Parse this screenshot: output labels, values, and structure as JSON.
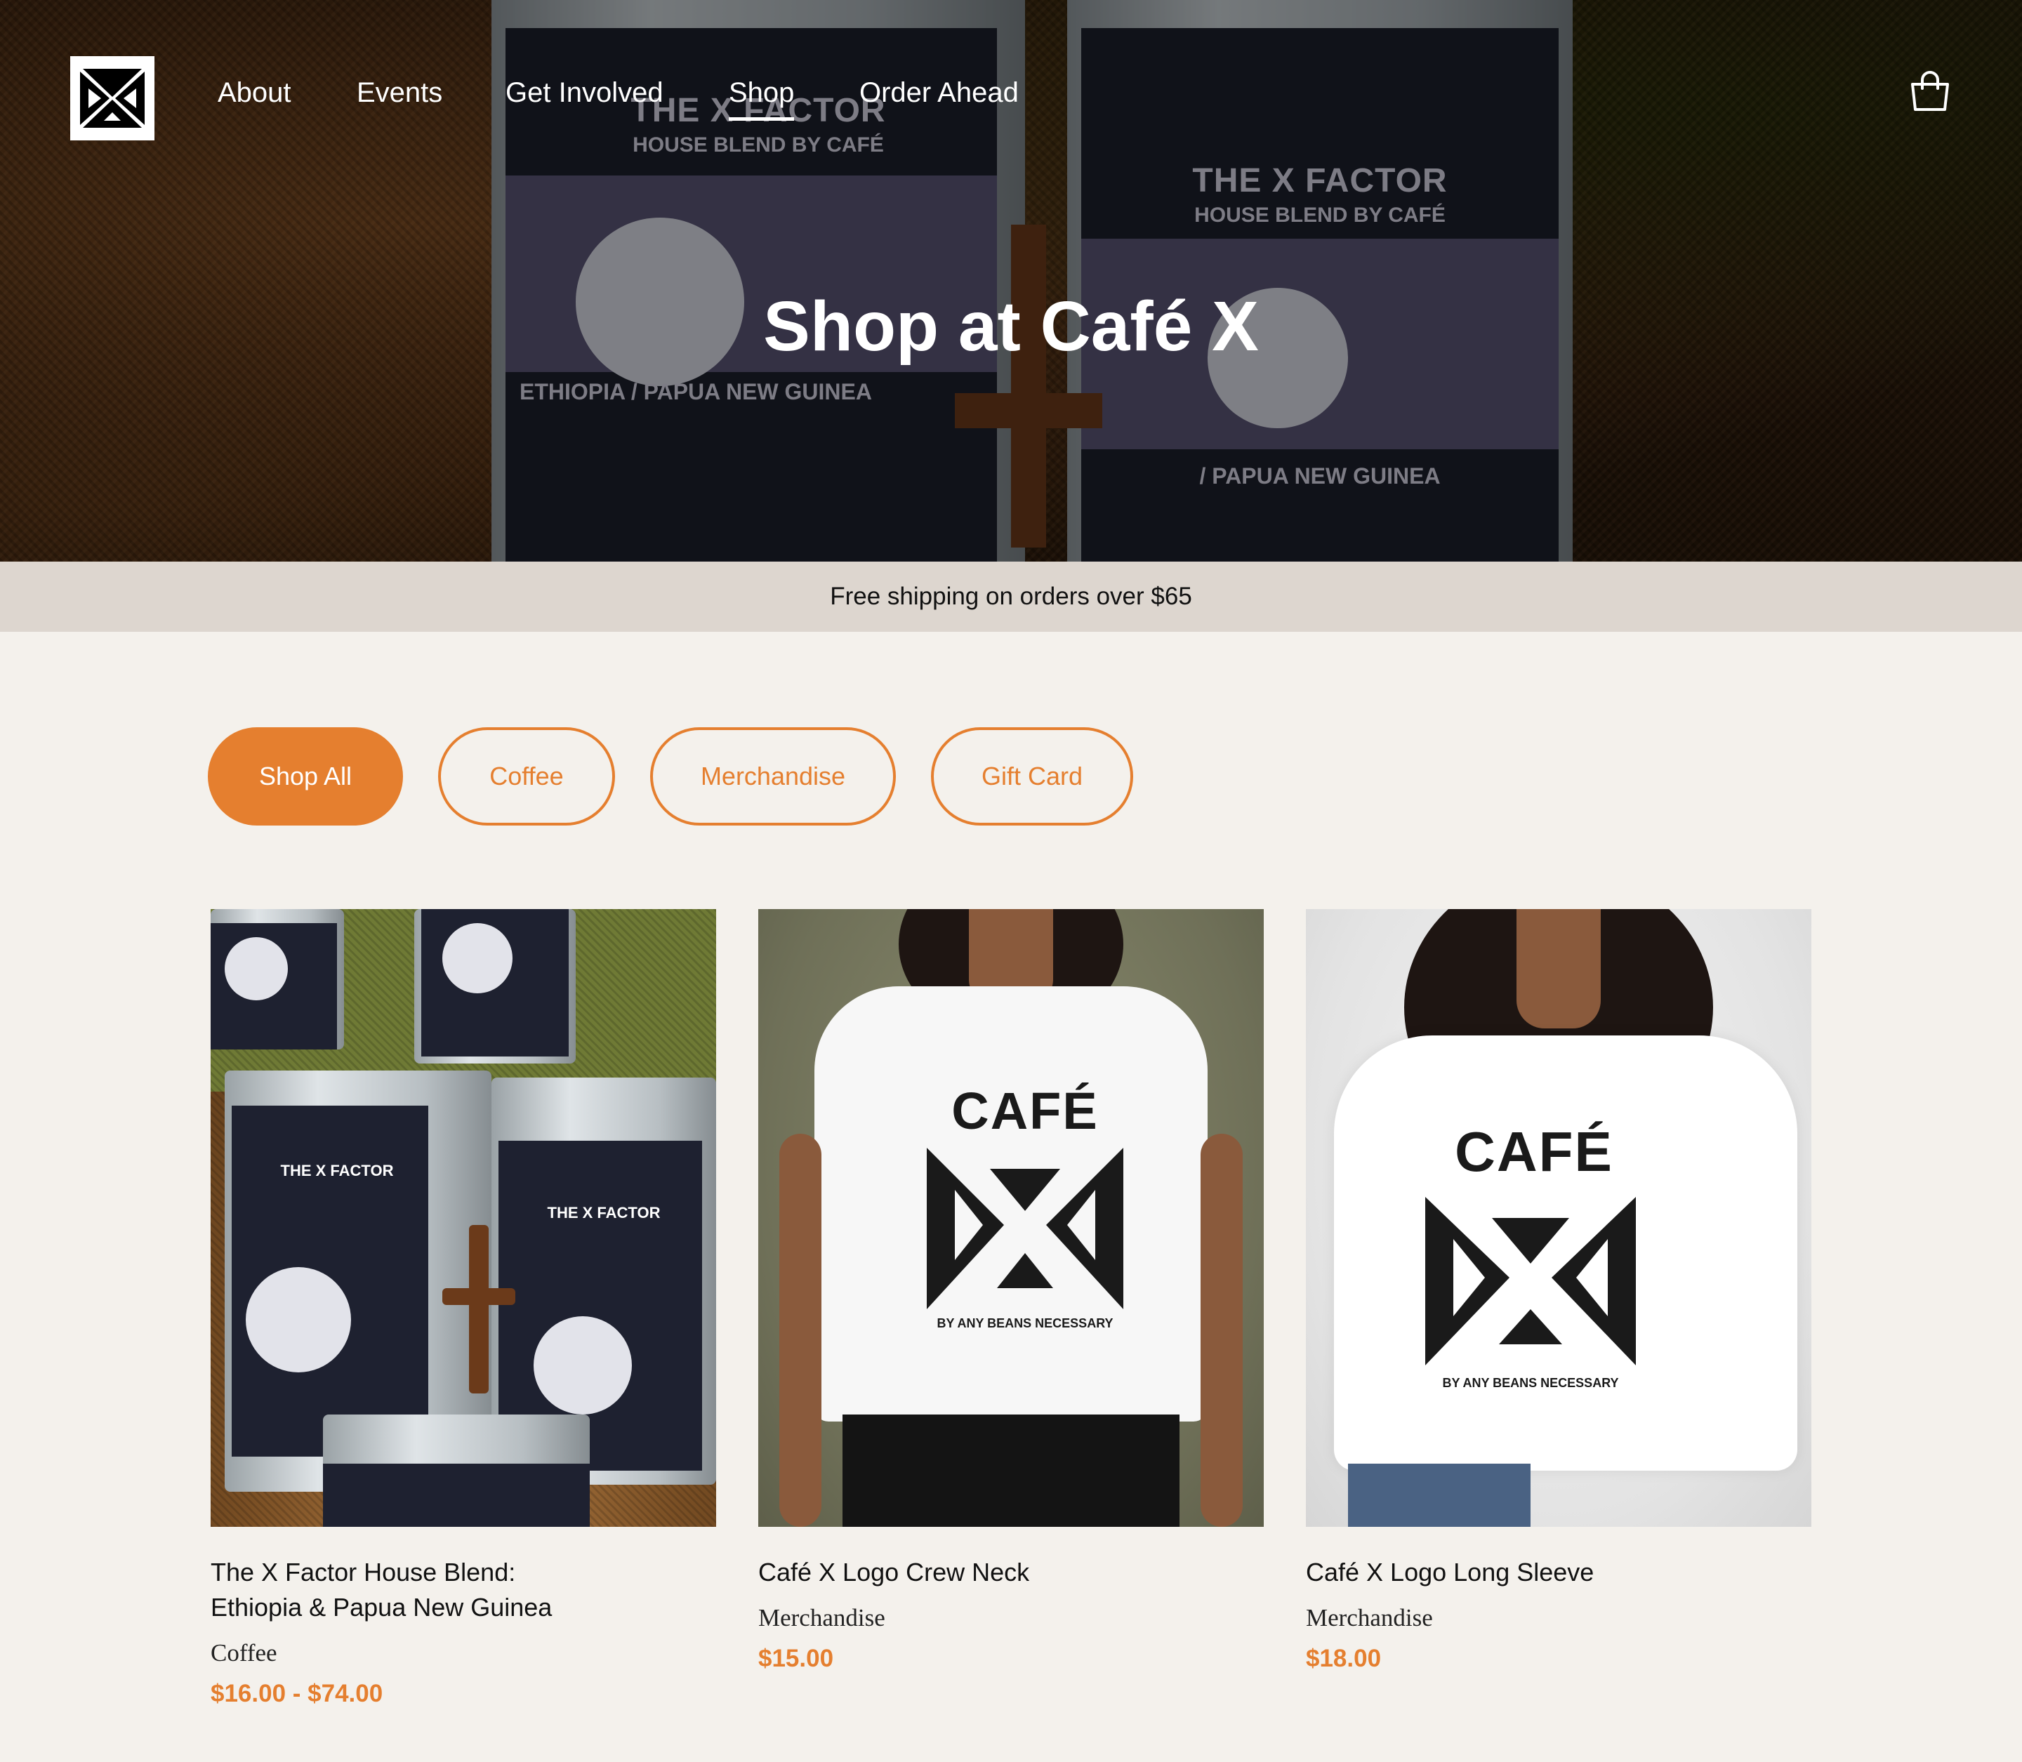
{
  "nav": {
    "items": [
      {
        "label": "About"
      },
      {
        "label": "Events"
      },
      {
        "label": "Get Involved"
      },
      {
        "label": "Shop"
      },
      {
        "label": "Order Ahead"
      }
    ],
    "active": "Shop",
    "logo_icon": "cafe-x-logo",
    "cart_icon": "shopping-bag-icon"
  },
  "hero": {
    "title": "Shop at Café X"
  },
  "banner": {
    "text": "Free shipping on orders over $65"
  },
  "filters": [
    {
      "label": "Shop All",
      "active": true
    },
    {
      "label": "Coffee",
      "active": false
    },
    {
      "label": "Merchandise",
      "active": false
    },
    {
      "label": "Gift Card",
      "active": false
    }
  ],
  "products": [
    {
      "name": "The X Factor House Blend: Ethiopia & Papua New Guinea",
      "category": "Coffee",
      "price": "$16.00 - $74.00"
    },
    {
      "name": "Café X Logo Crew Neck",
      "category": "Merchandise",
      "price": "$15.00"
    },
    {
      "name": "Café X Logo Long Sleeve",
      "category": "Merchandise",
      "price": "$18.00"
    }
  ],
  "colors": {
    "accent": "#e57f2f",
    "background": "#f4f1ec",
    "banner": "#ddd6cf"
  }
}
